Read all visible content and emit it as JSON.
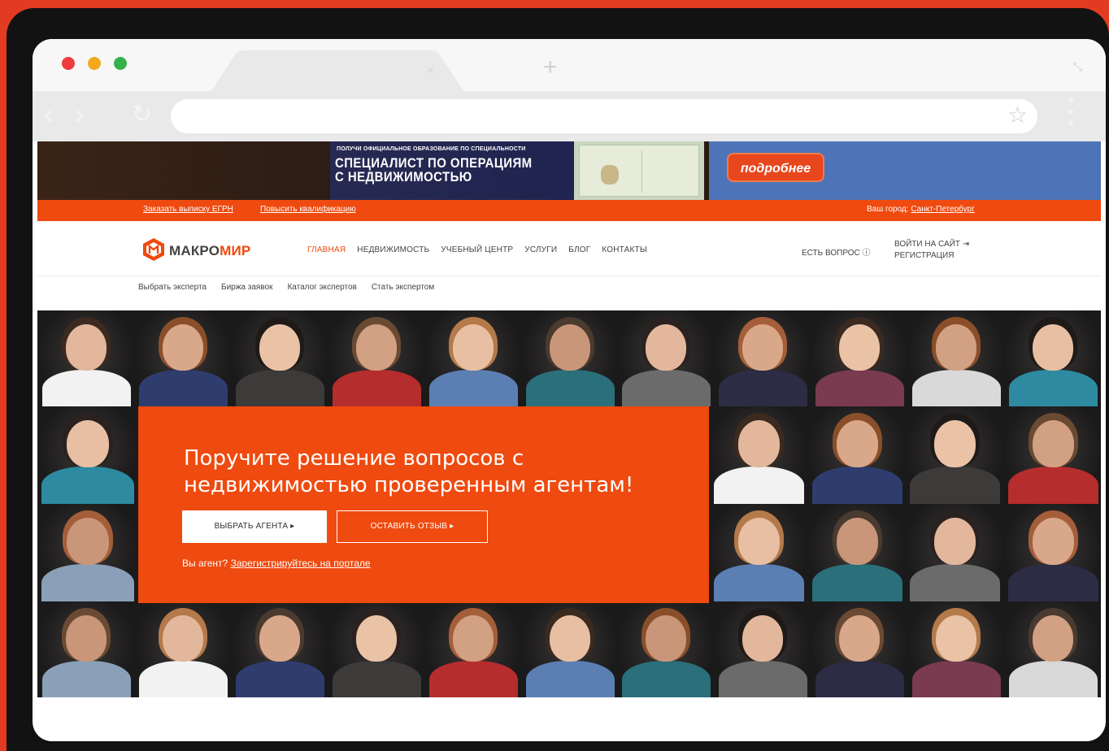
{
  "browser": {
    "tab_close": "×",
    "new_tab": "+",
    "nav_back": "‹",
    "nav_forward": "›",
    "nav_reload": "↻",
    "star": "☆",
    "expand": "⤡"
  },
  "banner": {
    "small_text": "ПОЛУЧИ ОФИЦИАЛЬНОЕ ОБРАЗОВАНИЕ ПО СПЕЦИАЛЬНОСТИ",
    "title": "СПЕЦИАЛИСТ ПО ОПЕРАЦИЯМ\nС НЕДВИЖИМОСТЬЮ",
    "button": "подробнее"
  },
  "topbar": {
    "link_egrn": "Заказать выписку ЕГРН",
    "link_qualification": "Повысить квалификацию",
    "city_label": "Ваш город:",
    "city": "Санкт-Петербург"
  },
  "logo": {
    "part1": "МАКРО",
    "part2": "МИР"
  },
  "nav": {
    "items": [
      "ГЛАВНАЯ",
      "НЕДВИЖИМОСТЬ",
      "УЧЕБНЫЙ ЦЕНТР",
      "УСЛУГИ",
      "БЛОГ",
      "КОНТАКТЫ"
    ],
    "active_index": 0,
    "ask": "ЕСТЬ ВОПРОС ⓘ",
    "login": "ВОЙТИ НА САЙТ ⇥",
    "register": "РЕГИСТРАЦИЯ"
  },
  "subnav": {
    "items": [
      "Выбрать эксперта",
      "Биржа заявок",
      "Каталог экспертов",
      "Стать экспертом"
    ]
  },
  "hero": {
    "title": "Поручите решение вопросов с недвижимостью проверенным агентам!",
    "button_agent": "ВЫБРАТЬ АГЕНТА  ▸",
    "button_review": "ОСТАВИТЬ ОТЗЫВ  ▸",
    "reg_prefix": "Вы агент?",
    "reg_link": "Зарегистрируйтесь на портале"
  },
  "colors": {
    "accent": "#ef4a0f",
    "frame_red": "#e33b22",
    "banner_blue": "#4d74b8"
  }
}
